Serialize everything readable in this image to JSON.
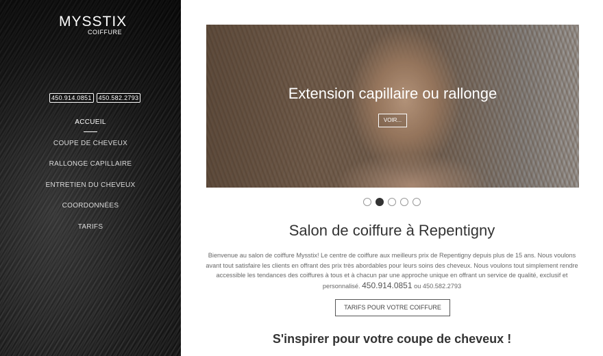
{
  "logo": {
    "main": "MYSSTIX",
    "sub": "COIFFURE"
  },
  "phones": [
    "450.914.0851",
    "450.582.2793"
  ],
  "nav": [
    {
      "label": "ACCUEIL",
      "active": true
    },
    {
      "label": "COUPE DE CHEVEUX"
    },
    {
      "label": "RALLONGE CAPILLAIRE"
    },
    {
      "label": "ENTRETIEN DU CHEVEUX"
    },
    {
      "label": "COORDONNÉES"
    },
    {
      "label": "TARIFS"
    }
  ],
  "slider": {
    "title": "Extension capillaire ou rallonge",
    "button": "VOIR...",
    "dots": 5,
    "active_dot": 2
  },
  "section": {
    "title": "Salon de coiffure à Repentigny",
    "intro_text": "Bienvenue au salon de coiffure Mysstix! Le centre de coiffure aux meilleurs prix de Repentigny depuis plus de 15 ans. Nous voulons avant tout satisfaire les clients en offrant des prix très abordables pour leurs soins des cheveux. Nous voulons tout simplement rendre accessible les tendances des coiffures à tous et à chacun par une approche unique en offrant un service de qualité, exclusif et personnalisé.",
    "phone_main": "450.914.0851",
    "phone_or": "ou",
    "phone_alt": "450.582.2793",
    "cta": "TARIFS POUR VOTRE COIFFURE",
    "subtitle": "S'inspirer pour votre coupe de cheveux !"
  }
}
